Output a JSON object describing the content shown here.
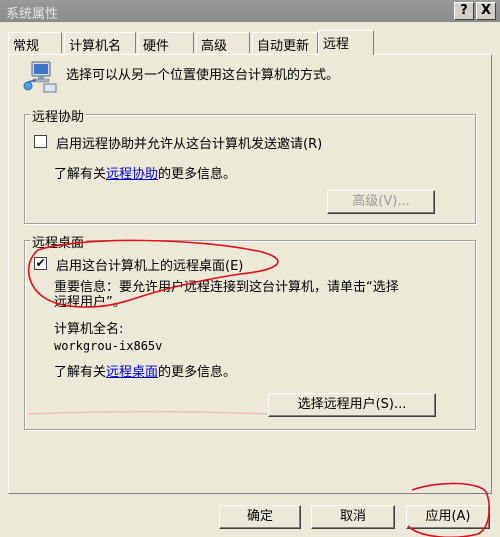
{
  "window": {
    "title": "系统属性",
    "help_label": "?",
    "close_label": "X"
  },
  "tabs": [
    {
      "label": "常规"
    },
    {
      "label": "计算机名"
    },
    {
      "label": "硬件"
    },
    {
      "label": "高级"
    },
    {
      "label": "自动更新"
    },
    {
      "label": "远程"
    }
  ],
  "remote": {
    "intro": "选择可以从另一个位置使用这台计算机的方式。",
    "assistance": {
      "group_title": "远程协助",
      "checkbox_label": "启用远程协助并允许从这台计算机发送邀请(R)",
      "checked": false,
      "info_prefix": "了解有关",
      "info_link": "远程协助",
      "info_suffix": "的更多信息。",
      "advanced_button": "高级(V)..."
    },
    "desktop": {
      "group_title": "远程桌面",
      "checkbox_label": "启用这台计算机上的远程桌面(E)",
      "checked": true,
      "check_mark": "✔",
      "important_line1": "重要信息：要允许用户远程连接到这台计算机，请单击“选择",
      "important_line2": "远程用户”。",
      "fullname_label": "计算机全名:",
      "fullname_value": "workgrou-ix865v",
      "info_prefix": "了解有关",
      "info_link": "远程桌面",
      "info_suffix": "的更多信息。",
      "select_users_button": "选择远程用户(S)..."
    }
  },
  "footer": {
    "ok_button": "确定",
    "cancel_button": "取消",
    "apply_button": "应用(A)"
  },
  "colors": {
    "annotation": "#e0101a",
    "link": "#0000cc"
  }
}
